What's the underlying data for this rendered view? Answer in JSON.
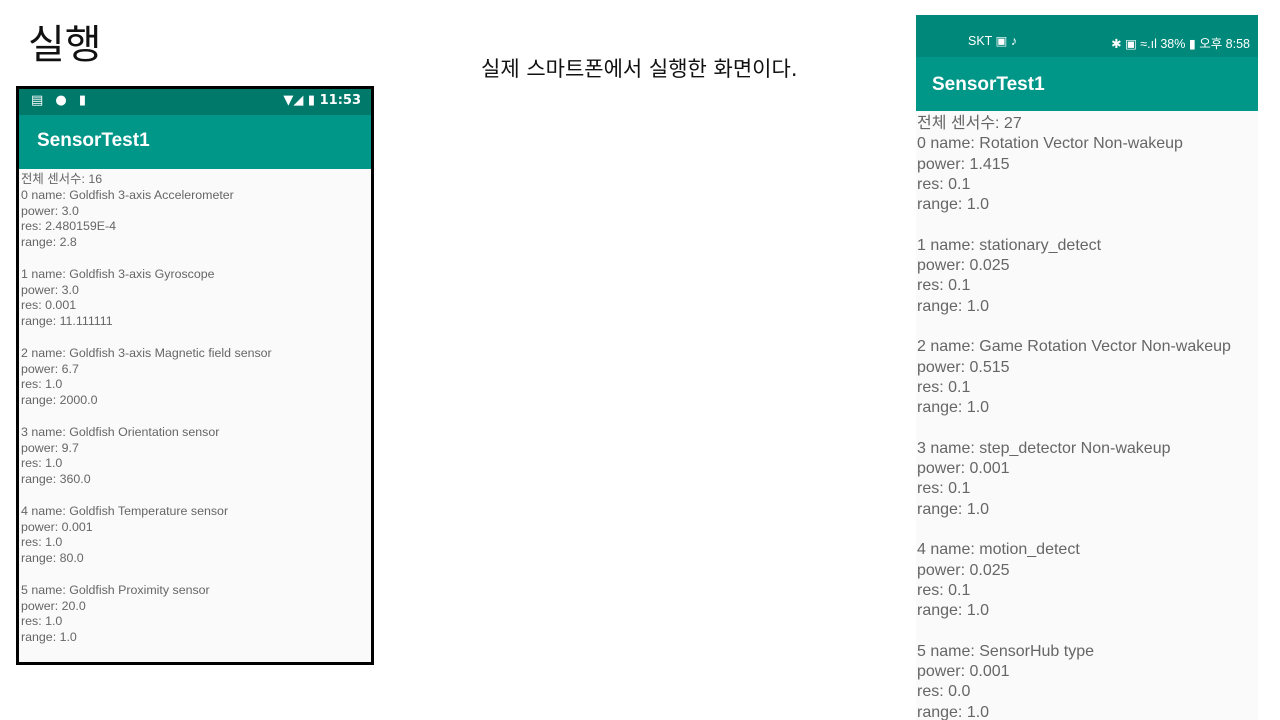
{
  "slide": {
    "title": "실행",
    "caption": "실제 스마트폰에서 실행한 화면이다."
  },
  "emulator": {
    "status_left_icons": "▤ ● ▮",
    "status_right": "▼◢ ▮ 11:53",
    "app_title": "SensorTest1",
    "total": "전체 센서수: 16",
    "sensors": [
      {
        "name": "0 name: Goldfish 3-axis Accelerometer",
        "power": "power: 3.0",
        "res": "res: 2.480159E-4",
        "range": "range: 2.8"
      },
      {
        "name": "1 name: Goldfish 3-axis Gyroscope",
        "power": "power: 3.0",
        "res": "res: 0.001",
        "range": "range: 11.111111"
      },
      {
        "name": "2 name: Goldfish 3-axis Magnetic field sensor",
        "power": "power: 6.7",
        "res": "res: 1.0",
        "range": "range: 2000.0"
      },
      {
        "name": "3 name: Goldfish Orientation sensor",
        "power": "power: 9.7",
        "res": "res: 1.0",
        "range": "range: 360.0"
      },
      {
        "name": "4 name: Goldfish Temperature sensor",
        "power": "power: 0.001",
        "res": "res: 1.0",
        "range": "range: 80.0"
      },
      {
        "name": "5 name: Goldfish Proximity sensor",
        "power": "power: 20.0",
        "res": "res: 1.0",
        "range": "range: 1.0"
      }
    ]
  },
  "device": {
    "status_left": "SKT ▣ ♪",
    "status_right": "✱ ▣ ≈.ıl 38% ▮ 오후 8:58",
    "app_title": "SensorTest1",
    "total": "전체 센서수: 27",
    "sensors": [
      {
        "name": "0 name: Rotation Vector  Non-wakeup",
        "power": "power: 1.415",
        "res": "res: 0.1",
        "range": "range: 1.0"
      },
      {
        "name": "1 name: stationary_detect",
        "power": "power: 0.025",
        "res": "res: 0.1",
        "range": "range: 1.0"
      },
      {
        "name": "2 name: Game Rotation Vector  Non-wakeup",
        "power": "power: 0.515",
        "res": "res: 0.1",
        "range": "range: 1.0"
      },
      {
        "name": "3 name: step_detector  Non-wakeup",
        "power": "power: 0.001",
        "res": "res: 0.1",
        "range": "range: 1.0"
      },
      {
        "name": "4 name: motion_detect",
        "power": "power: 0.025",
        "res": "res: 0.1",
        "range": "range: 1.0"
      },
      {
        "name": "5 name: SensorHub type",
        "power": "power: 0.001",
        "res": "res: 0.0",
        "range": "range: 1.0"
      }
    ]
  }
}
